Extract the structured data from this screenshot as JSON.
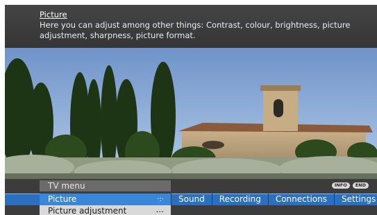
{
  "info": {
    "title": "Picture",
    "description": "Here you can adjust among other things: Contrast, colour, brightness, picture adjustment, sharpness, picture format."
  },
  "menu": {
    "title": "TV menu",
    "keys": [
      "INFO",
      "END"
    ],
    "active_tab": {
      "label": "Picture",
      "symbol": "·:·"
    },
    "tabs": [
      "Sound",
      "Recording",
      "Connections",
      "Settings"
    ],
    "sub_item": {
      "label": "Picture adjustment",
      "more": "..."
    }
  },
  "colors": {
    "tab_bar": "#2a6fc0",
    "active_tab": "#3a86d8",
    "header_bg": "#3d3d3d",
    "sub_item_bg": "#d9d9d9"
  }
}
